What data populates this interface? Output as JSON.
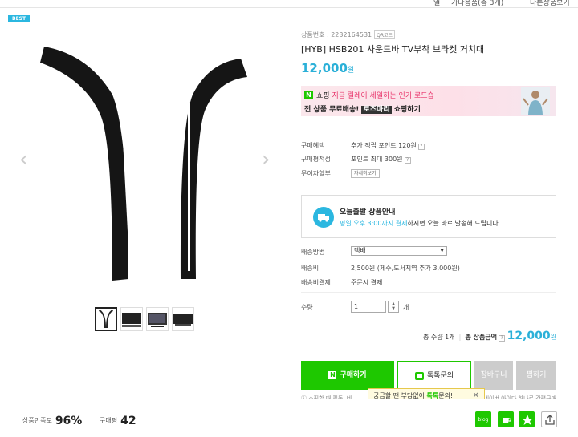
{
  "top_strip": {
    "left": "열",
    "center": "가다용품(총 3개)",
    "right": "다른상품보기"
  },
  "gallery": {
    "best_badge": "BEST",
    "prev_arrow": "‹",
    "next_arrow": "›",
    "thumbnails": 4,
    "selected_thumbnail": 1
  },
  "product": {
    "id_label": "상품번호 : 2232164531",
    "qr_label": "QR코드",
    "title": "[HYB] HSB201 사운드바 TV부착 브라켓 거치대",
    "price": "12,000",
    "price_unit": "원"
  },
  "banner": {
    "line1_pre": "쇼핑",
    "line1_hl": "지금 릴레이 세일하는 인기 로드숍",
    "line2_pre": "전 상품 무료배송!",
    "line2_hl": "로즈마리",
    "line2_post": "쇼핑하기"
  },
  "rows": {
    "benefit_label": "구매혜택",
    "benefit_value": "추가 적립 포인트 120원",
    "reward_label": "구매평적성",
    "reward_value": "포인트 최대 300원",
    "interest_label": "무이자할부",
    "interest_btn": "자세히보기"
  },
  "today_ship": {
    "title": "오늘출발 상품안내",
    "desc_pre": "평일 오후 3:00까지 결제",
    "desc_post": "하시면 오늘 바로 발송해 드립니다"
  },
  "shipping": {
    "method_label": "배송방법",
    "method_value": "택배",
    "fee_label": "배송비",
    "fee_value": "2,500원 (제주,도서지역 추가 3,000원)",
    "pay_label": "배송비결제",
    "pay_value": "주문시 결제"
  },
  "quantity": {
    "label": "수량",
    "value": "1",
    "unit": "개"
  },
  "totals": {
    "count_label": "총 수량 1개",
    "price_label": "총 상품금액",
    "price_value": "12,000",
    "price_unit": "원"
  },
  "buttons": {
    "buy": "구매하기",
    "talk": "톡톡문의",
    "cart": "장바구니",
    "wish": "찜하기"
  },
  "note": {
    "left": "쇼핑할 때 필독, 네",
    "right": "네이버 아이다 하나로 간편구매"
  },
  "tooltip": {
    "pre": "궁금할 땐 부담없이",
    "hl": "톡톡",
    "post": "문의!",
    "close": "✕"
  },
  "stats": {
    "satisfaction_label": "상품만족도",
    "satisfaction_value": "96%",
    "review_label": "구매평",
    "review_value": "42"
  },
  "share": {
    "blog_label": "blog"
  },
  "colors": {
    "accent": "#2bb0d8",
    "naver_green": "#1ec800",
    "pink": "#e8336a"
  }
}
